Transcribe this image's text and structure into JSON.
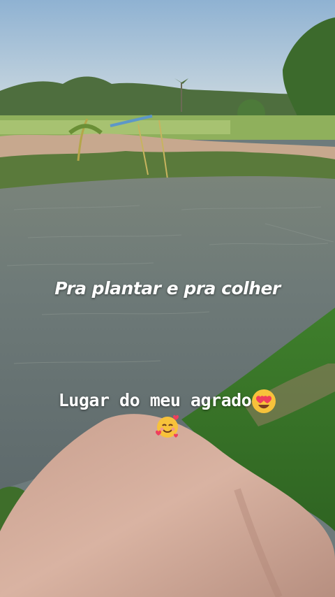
{
  "captions": {
    "main": "Pra plantar e pra colher",
    "sub": "Lugar do meu agrado"
  },
  "stickers": {
    "first": "heart-eyes-emoji",
    "second": "smiling-face-with-hearts-emoji"
  },
  "colors": {
    "sky": "#a9c3d6",
    "water": "#6b7877",
    "grass": "#3f7a2a",
    "skin": "#d4ab98"
  }
}
